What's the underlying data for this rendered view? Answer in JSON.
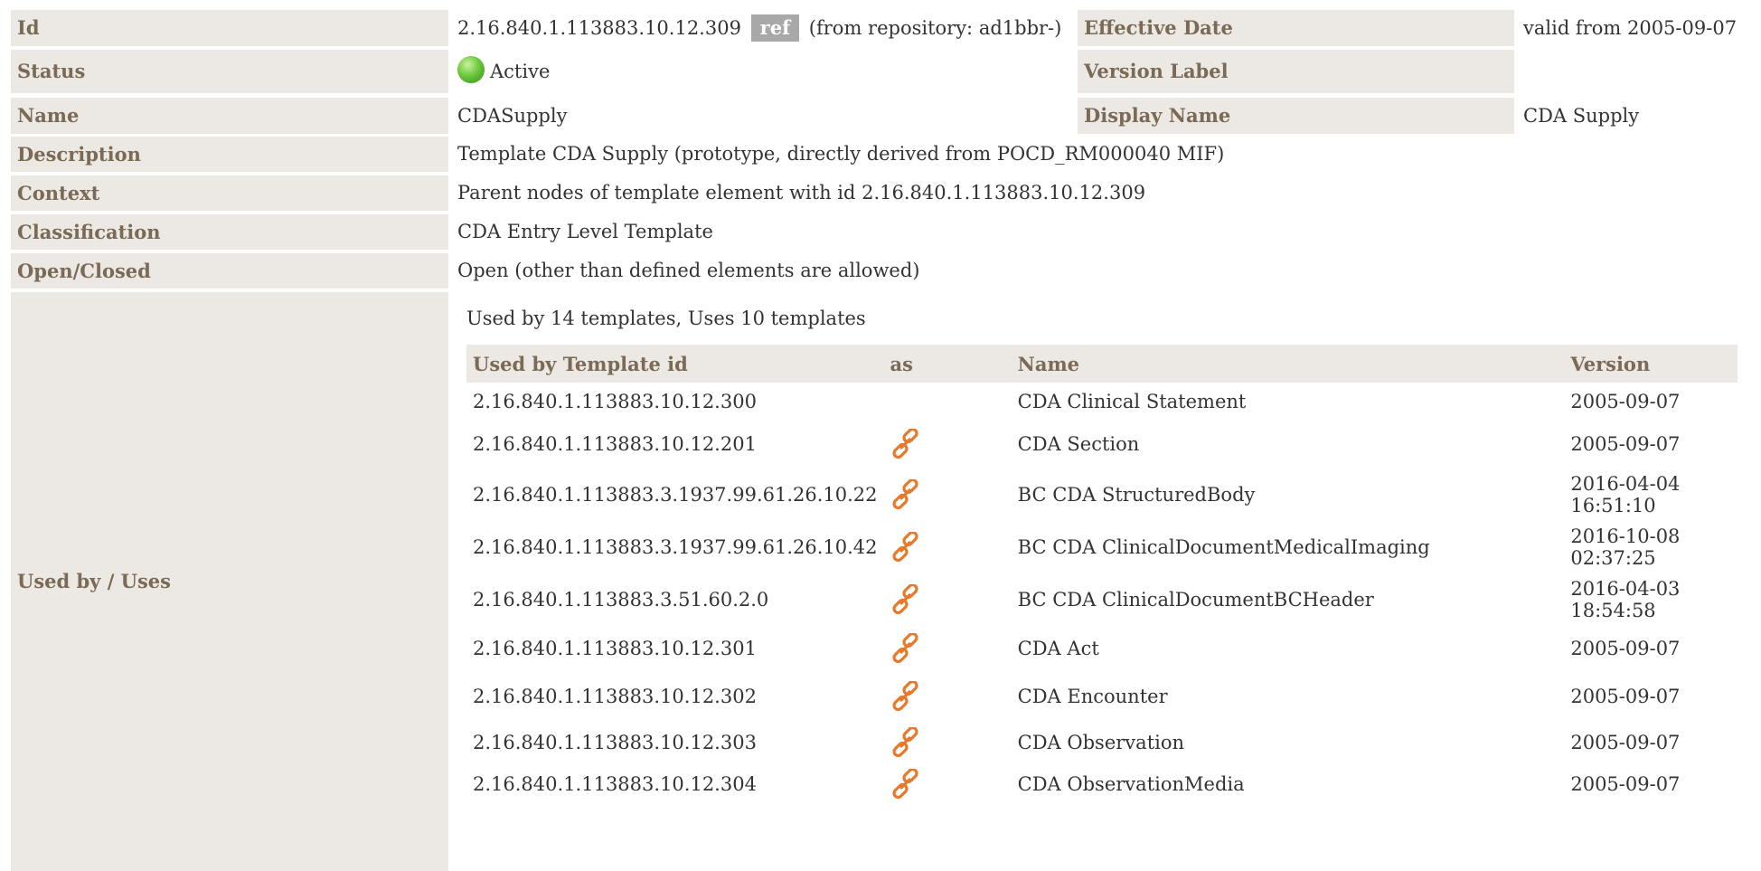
{
  "fields": {
    "id": {
      "label": "Id",
      "value": "2.16.840.1.113883.10.12.309",
      "ref": "ref",
      "from": "(from repository: ad1bbr-)"
    },
    "effective_date": {
      "label": "Effective Date",
      "value": "valid from 2005-09-07"
    },
    "status": {
      "label": "Status",
      "value": "Active"
    },
    "version_label": {
      "label": "Version Label",
      "value": ""
    },
    "name": {
      "label": "Name",
      "value": "CDASupply"
    },
    "display_name": {
      "label": "Display Name",
      "value": "CDA Supply"
    },
    "description": {
      "label": "Description",
      "value": "Template CDA Supply (prototype, directly derived from POCD_RM000040 MIF)"
    },
    "context": {
      "label": "Context",
      "value": "Parent nodes of template element with id 2.16.840.1.113883.10.12.309"
    },
    "classification": {
      "label": "Classification",
      "value": "CDA Entry Level Template"
    },
    "open_closed": {
      "label": "Open/Closed",
      "value": "Open (other than defined elements are allowed)"
    },
    "used_by": {
      "label": "Used by / Uses"
    }
  },
  "usage": {
    "summary": "Used by 14 templates, Uses 10 templates",
    "columns": [
      "Used by Template id",
      "as",
      "Name",
      "Version"
    ],
    "rows": [
      {
        "id": "2.16.840.1.113883.10.12.300",
        "as_icon": "",
        "name": "CDA Clinical Statement",
        "version": "2005-09-07"
      },
      {
        "id": "2.16.840.1.113883.10.12.201",
        "as_icon": "link-icon",
        "name": "CDA Section",
        "version": "2005-09-07"
      },
      {
        "id": "2.16.840.1.113883.3.1937.99.61.26.10.22",
        "as_icon": "link-icon",
        "name": "BC CDA StructuredBody",
        "version": "2016-04-04 16:51:10"
      },
      {
        "id": "2.16.840.1.113883.3.1937.99.61.26.10.42",
        "as_icon": "link-icon",
        "name": "BC CDA ClinicalDocumentMedicalImaging",
        "version": "2016-10-08 02:37:25"
      },
      {
        "id": "2.16.840.1.113883.3.51.60.2.0",
        "as_icon": "link-icon",
        "name": "BC CDA ClinicalDocumentBCHeader",
        "version": "2016-04-03 18:54:58"
      },
      {
        "id": "2.16.840.1.113883.10.12.301",
        "as_icon": "link-icon",
        "name": "CDA Act",
        "version": "2005-09-07"
      },
      {
        "id": "2.16.840.1.113883.10.12.302",
        "as_icon": "link-icon",
        "name": "CDA Encounter",
        "version": "2005-09-07"
      },
      {
        "id": "2.16.840.1.113883.10.12.303",
        "as_icon": "link-icon",
        "name": "CDA Observation",
        "version": "2005-09-07"
      },
      {
        "id": "2.16.840.1.113883.10.12.304",
        "as_icon": "link-icon",
        "name": "CDA ObservationMedia",
        "version": "2005-09-07"
      }
    ]
  },
  "colors": {
    "label_bg": "#ece9e4",
    "label_text": "#7a6a56",
    "ref_badge": "#a8a8a8",
    "status_active": "#5cb82e",
    "link_icon": "#e8782a"
  }
}
